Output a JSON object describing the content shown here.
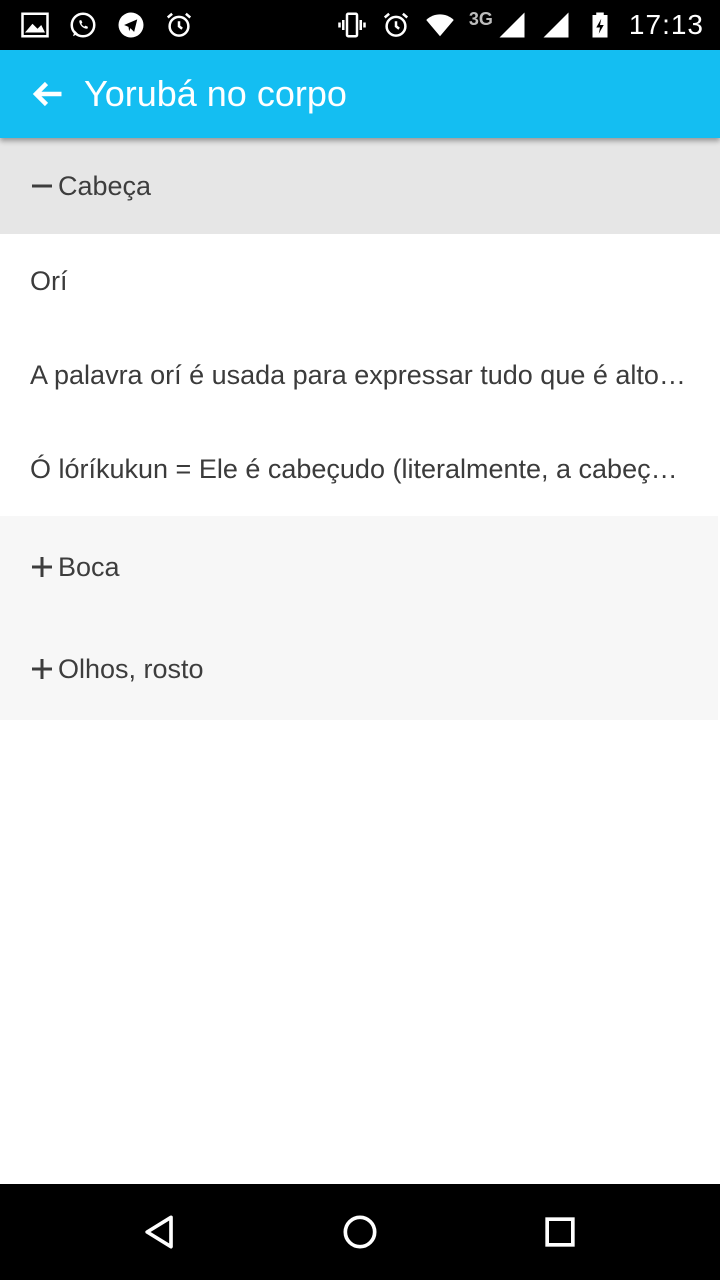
{
  "status_bar": {
    "left_icons": [
      "gallery-icon",
      "whatsapp-icon",
      "telegram-icon",
      "alarm-icon"
    ],
    "right_icons": [
      "vibrate-icon",
      "alarm-icon",
      "wifi-icon",
      "signal-icon",
      "signal-icon",
      "battery-charging-icon"
    ],
    "network_type": "3G",
    "time": "17:13"
  },
  "app_bar": {
    "title": "Yorubá no corpo",
    "back_icon": "arrow-left-icon",
    "color": "#14bef2"
  },
  "expanded_group": {
    "sign": "minus-icon",
    "label": "Cabeça",
    "children": [
      "Orí",
      "A palavra orí é usada para expressar tudo que é alto e elevado",
      "Ó lóríkukun = Ele é cabeçudo (literalmente, a cabeça dura)"
    ]
  },
  "collapsed_groups": [
    {
      "sign": "plus-icon",
      "label": "Boca"
    },
    {
      "sign": "plus-icon",
      "label": "Olhos, rosto"
    }
  ],
  "nav_bar": {
    "buttons": [
      "back-triangle-icon",
      "home-circle-icon",
      "recents-square-icon"
    ]
  }
}
